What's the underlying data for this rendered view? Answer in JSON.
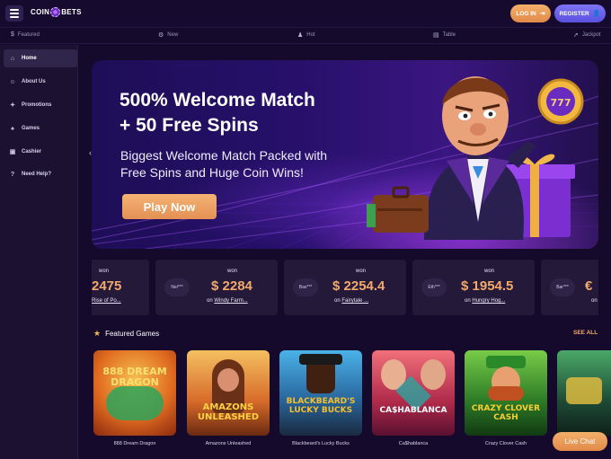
{
  "header": {
    "logo_left": "COIN",
    "logo_right": "BETS",
    "login_label": "LOG IN",
    "register_label": "REGISTER"
  },
  "categories": [
    {
      "label": "Featured",
      "icon": "dollar-icon"
    },
    {
      "label": "New",
      "icon": "gear-icon"
    },
    {
      "label": "Hot",
      "icon": "person-icon"
    },
    {
      "label": "Table",
      "icon": "table-icon"
    },
    {
      "label": "Jackpot",
      "icon": "rocket-icon"
    }
  ],
  "sidebar": {
    "items": [
      {
        "label": "Home",
        "icon": "home-icon",
        "active": true
      },
      {
        "label": "About Us",
        "icon": "user-icon"
      },
      {
        "label": "Promotions",
        "icon": "gift-icon"
      },
      {
        "label": "Games",
        "icon": "cards-icon"
      },
      {
        "label": "Cashier",
        "icon": "wallet-icon"
      },
      {
        "label": "Need Help?",
        "icon": "help-icon"
      }
    ]
  },
  "banner": {
    "title_line1": "500% Welcome Match",
    "title_line2": "+ 50 Free Spins",
    "subtitle_line1": "Biggest Welcome Match Packed with",
    "subtitle_line2": "Free Spins and Huge Coin Wins!",
    "cta_label": "Play Now",
    "coin_text": "777"
  },
  "winners": [
    {
      "player": "",
      "won": "won",
      "amount": "2475",
      "on": "",
      "game": "Rise of Po..."
    },
    {
      "player": "Nei***",
      "won": "won",
      "amount": "$ 2284",
      "on": "on",
      "game": "Windy Farm..."
    },
    {
      "player": "Bas***",
      "won": "won",
      "amount": "$ 2254.4",
      "on": "on",
      "game": "Fairytale ..."
    },
    {
      "player": "Eth***",
      "won": "won",
      "amount": "$ 1954.5",
      "on": "on",
      "game": "Hungry Hog..."
    },
    {
      "player": "Bar***",
      "won": "",
      "amount": "€",
      "on": "on",
      "game": ""
    }
  ],
  "featured": {
    "heading": "Featured Games",
    "see_all": "SEE ALL",
    "games": [
      {
        "name": "888 Dream Dragon",
        "thumb_text": "888 DREAM DRAGON",
        "bg1": "#f0a030",
        "bg2": "#c0401a",
        "accent": "#2da55a"
      },
      {
        "name": "Amazons Unleashed",
        "thumb_text": "AMAZONS UNLEASHED",
        "bg1": "#f2b040",
        "bg2": "#b3501c",
        "accent": "#5a2410"
      },
      {
        "name": "Blackbeard's Lucky Bucks",
        "thumb_text": "BLACKBEARD'S LUCKY BUCKS",
        "bg1": "#40a8e0",
        "bg2": "#1a4070",
        "accent": "#e8b020"
      },
      {
        "name": "Ca$hablanca",
        "thumb_text": "CA$HABLANCA",
        "bg1": "#e05a6a",
        "bg2": "#7a1a3a",
        "accent": "#2aa5a0"
      },
      {
        "name": "Crazy Clover Cash",
        "thumb_text": "CRAZY CLOVER CASH",
        "bg1": "#6cc040",
        "bg2": "#206020",
        "accent": "#f0c020"
      },
      {
        "name": "",
        "thumb_text": "",
        "bg1": "#40a060",
        "bg2": "#1a3a30",
        "accent": "#f0c020"
      }
    ]
  },
  "live_chat_label": "Live Chat"
}
